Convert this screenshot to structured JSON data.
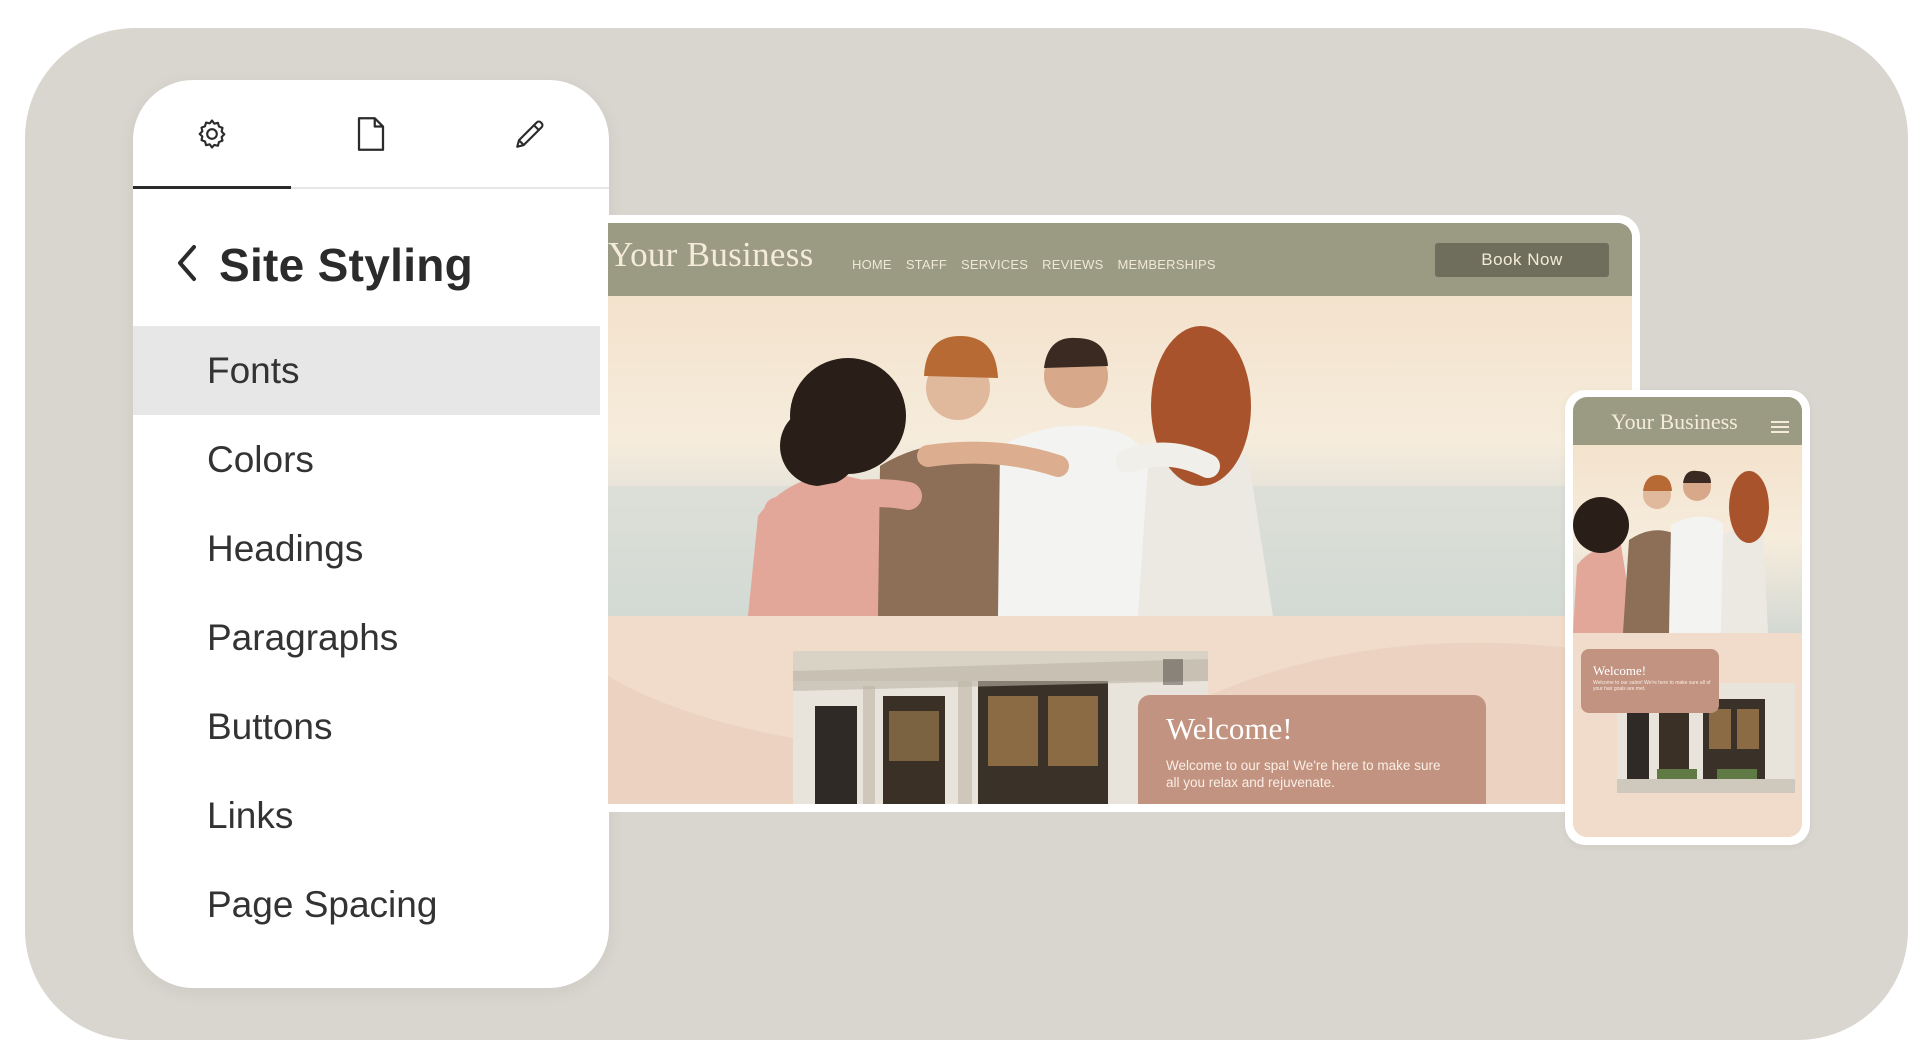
{
  "panel": {
    "tabs": [
      {
        "icon": "gear-icon"
      },
      {
        "icon": "page-icon"
      },
      {
        "icon": "pencil-icon"
      }
    ],
    "title": "Site Styling",
    "items": [
      "Fonts",
      "Colors",
      "Headings",
      "Paragraphs",
      "Buttons",
      "Links",
      "Page Spacing"
    ],
    "selected": "Fonts"
  },
  "desktop": {
    "brand": "Your Business",
    "nav": [
      "HOME",
      "STAFF",
      "SERVICES",
      "REVIEWS",
      "MEMBERSHIPS"
    ],
    "cta": "Book Now",
    "welcome_title": "Welcome!",
    "welcome_text": "Welcome to our spa! We're here to make sure all you relax and rejuvenate."
  },
  "mobile": {
    "brand": "Your Business",
    "menu_icon": "hamburger-icon",
    "welcome_title": "Welcome!",
    "welcome_text": "Welcome to our salon! We're here to make sure all of your hair goals are met."
  },
  "colors": {
    "stage": "#d9d6cf",
    "nav": "#9b9a83",
    "button": "#6f6e5c",
    "welcome_card": "#c19380",
    "page_bg": "#f1dccb"
  }
}
